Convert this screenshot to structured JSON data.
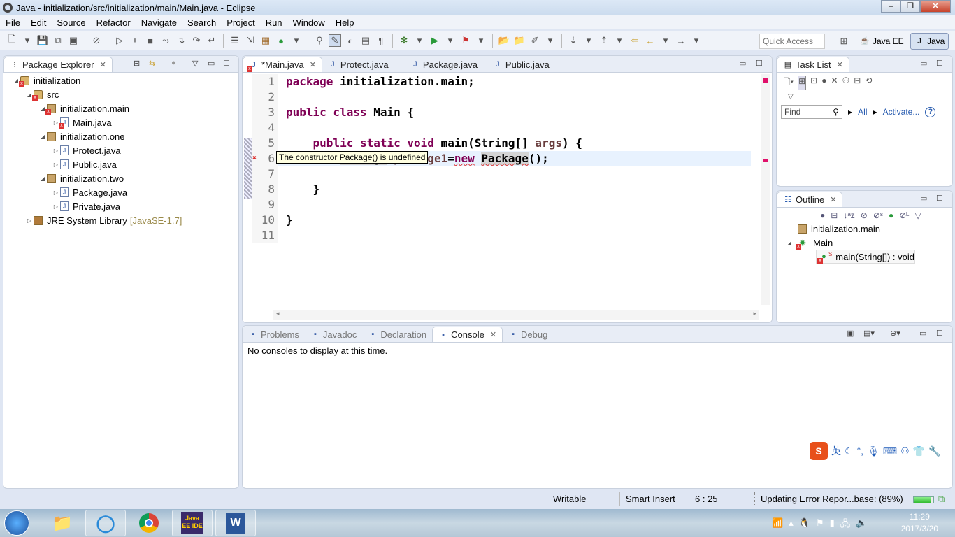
{
  "window": {
    "title": "Java - initialization/src/initialization/main/Main.java - Eclipse",
    "min": "–",
    "max": "❐",
    "close": "✕"
  },
  "menu": [
    "File",
    "Edit",
    "Source",
    "Refactor",
    "Navigate",
    "Search",
    "Project",
    "Run",
    "Window",
    "Help"
  ],
  "toolbar": {
    "quick_access_placeholder": "Quick Access",
    "perspectives": [
      {
        "label": "Java EE"
      },
      {
        "label": "Java",
        "active": true
      }
    ]
  },
  "package_explorer": {
    "title": "Package Explorer",
    "tree": [
      {
        "label": "initialization",
        "level": 0,
        "expanded": true,
        "icon": "project-icon",
        "error": true
      },
      {
        "label": "src",
        "level": 1,
        "expanded": true,
        "icon": "source-folder-icon",
        "error": true
      },
      {
        "label": "initialization.main",
        "level": 2,
        "expanded": true,
        "icon": "package-icon",
        "error": true
      },
      {
        "label": "Main.java",
        "level": 3,
        "expanded": false,
        "icon": "java-file-icon",
        "error": true
      },
      {
        "label": "initialization.one",
        "level": 2,
        "expanded": true,
        "icon": "package-icon"
      },
      {
        "label": "Protect.java",
        "level": 3,
        "expanded": false,
        "icon": "java-file-icon"
      },
      {
        "label": "Public.java",
        "level": 3,
        "expanded": false,
        "icon": "java-file-icon"
      },
      {
        "label": "initialization.two",
        "level": 2,
        "expanded": true,
        "icon": "package-icon"
      },
      {
        "label": "Package.java",
        "level": 3,
        "expanded": false,
        "icon": "java-file-icon"
      },
      {
        "label": "Private.java",
        "level": 3,
        "expanded": false,
        "icon": "java-file-icon"
      },
      {
        "label": "JRE System Library",
        "suffix": "[JavaSE-1.7]",
        "level": 1,
        "expanded": false,
        "icon": "library-icon"
      }
    ]
  },
  "editor": {
    "tabs": [
      {
        "label": "*Main.java",
        "active": true,
        "error": true
      },
      {
        "label": "Protect.java"
      },
      {
        "label": "Package.java"
      },
      {
        "label": "Public.java"
      }
    ],
    "lines": [
      {
        "n": "1",
        "tokens": [
          [
            "kw",
            "package"
          ],
          [
            "pl",
            " initialization.main;"
          ]
        ]
      },
      {
        "n": "2",
        "tokens": []
      },
      {
        "n": "3",
        "tokens": [
          [
            "kw",
            "public class"
          ],
          [
            "pl",
            " Main {"
          ]
        ]
      },
      {
        "n": "4",
        "tokens": []
      },
      {
        "n": "5",
        "tokens": [
          [
            "pl",
            "    "
          ],
          [
            "kw",
            "public static void"
          ],
          [
            "pl",
            " main(String[] "
          ],
          [
            "var",
            "args"
          ],
          [
            "pl",
            ") {"
          ]
        ]
      },
      {
        "n": "6",
        "tokens": [
          [
            "pl",
            "        "
          ],
          [
            "hl",
            "Package"
          ],
          [
            "pl",
            " "
          ],
          [
            "var",
            "package1"
          ],
          [
            "pl",
            "="
          ],
          [
            "kwsq",
            "new"
          ],
          [
            "pl",
            " "
          ],
          [
            "hlsq",
            "Package"
          ],
          [
            "pl",
            "();"
          ]
        ],
        "current": true,
        "error": true
      },
      {
        "n": "7",
        "tokens": []
      },
      {
        "n": "8",
        "tokens": [
          [
            "pl",
            "    }"
          ]
        ]
      },
      {
        "n": "9",
        "tokens": []
      },
      {
        "n": "10",
        "tokens": [
          [
            "pl",
            "}"
          ]
        ]
      },
      {
        "n": "11",
        "tokens": []
      }
    ],
    "tooltip": "The constructor Package() is undefined"
  },
  "task_list": {
    "title": "Task List",
    "find_placeholder": "Find",
    "all": "All",
    "activate": "Activate...",
    "help": "?"
  },
  "outline": {
    "title": "Outline",
    "items": [
      {
        "label": "initialization.main"
      },
      {
        "label": "Main"
      },
      {
        "label": "main(String[]) : void"
      }
    ]
  },
  "bottom": {
    "tabs": [
      {
        "label": "Problems"
      },
      {
        "label": "Javadoc"
      },
      {
        "label": "Declaration"
      },
      {
        "label": "Console",
        "active": true
      },
      {
        "label": "Debug"
      }
    ],
    "console_text": "No consoles to display at this time."
  },
  "status": {
    "writable": "Writable",
    "insert_mode": "Smart Insert",
    "position": "6 : 25",
    "progress_text": "Updating Error Repor...base: (89%)",
    "progress_percent": 89
  },
  "ime": {
    "lang": "英"
  },
  "taskbar": {
    "apps": [
      "Explorer",
      "Browser",
      "Chrome",
      "Java EE IDE",
      "Word"
    ],
    "java_label": "Java EE IDE",
    "word_label": "W",
    "time": "11:29",
    "date": "2017/3/20"
  }
}
